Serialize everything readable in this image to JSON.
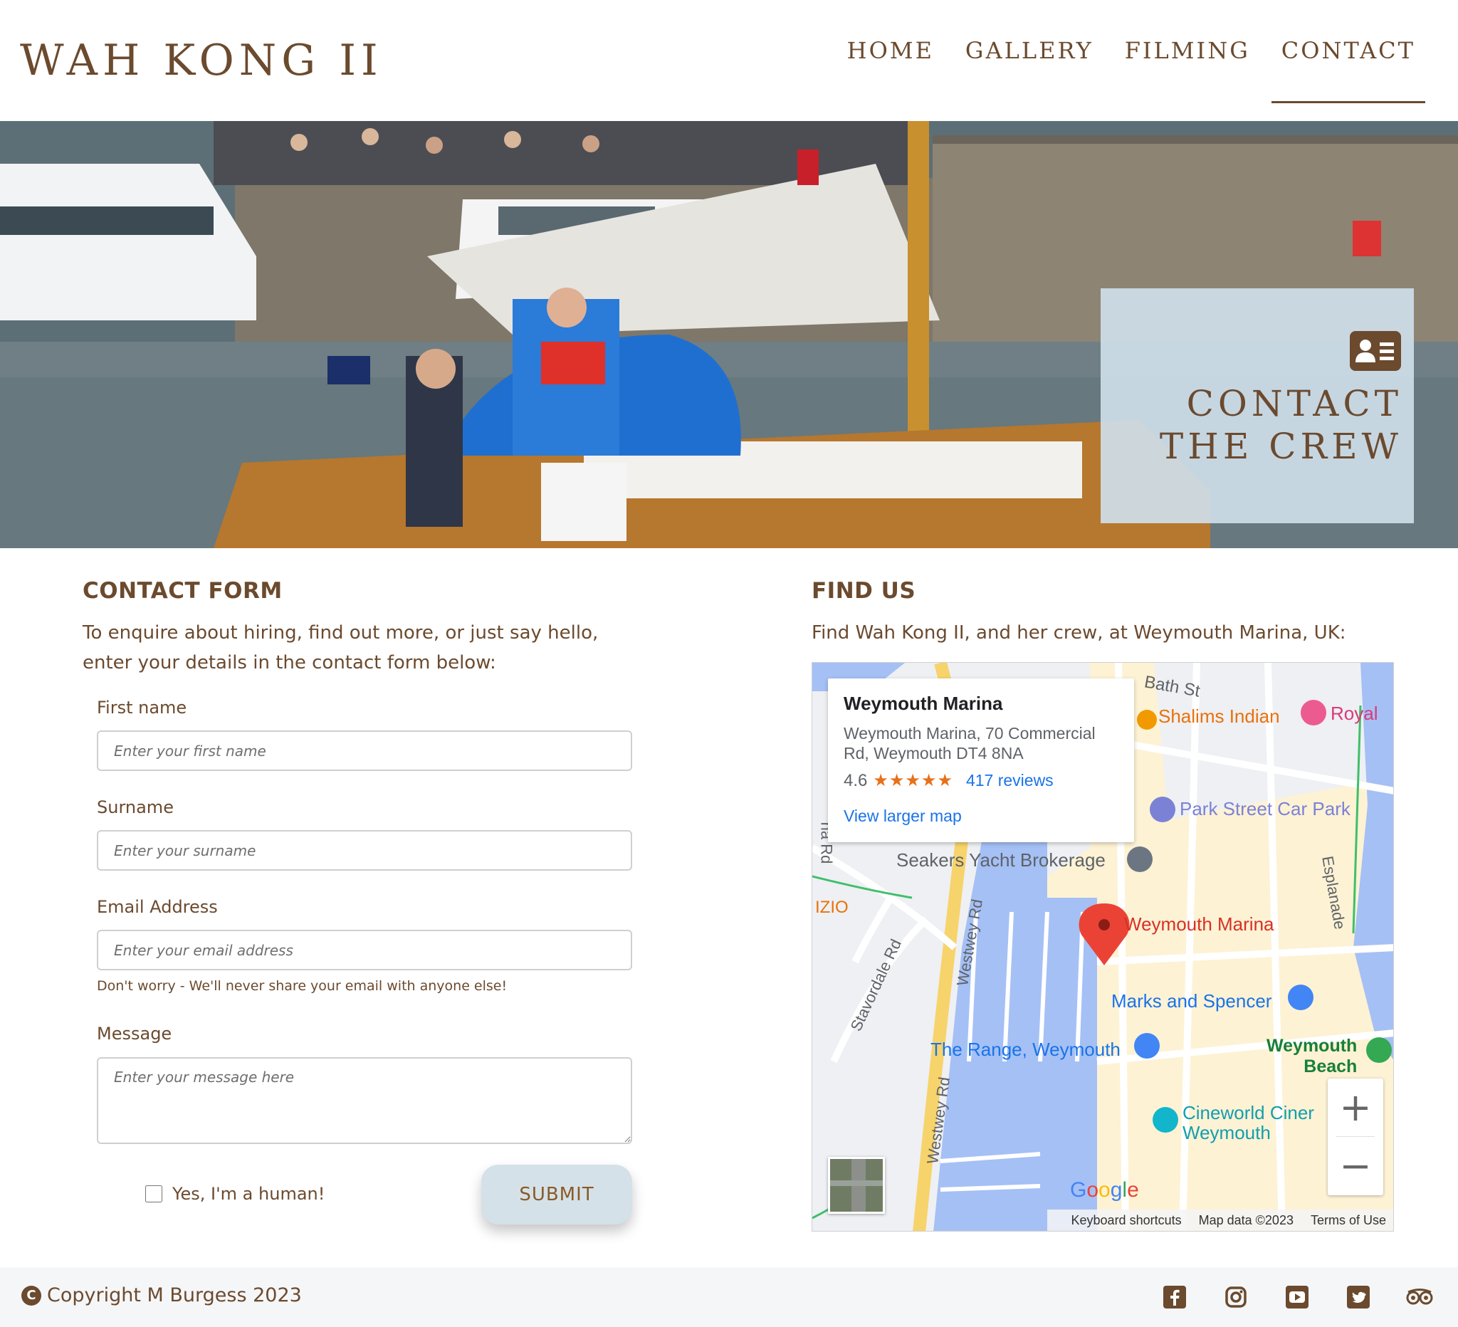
{
  "brand": {
    "title": "WAH KONG II"
  },
  "nav": {
    "items": [
      {
        "label": "HOME",
        "active": false
      },
      {
        "label": "GALLERY",
        "active": false
      },
      {
        "label": "FILMING",
        "active": false
      },
      {
        "label": "CONTACT",
        "active": true
      }
    ]
  },
  "hero": {
    "title_line1": "CONTACT",
    "title_line2": "THE CREW",
    "icon": "address-card-icon"
  },
  "contact_form": {
    "heading": "CONTACT FORM",
    "intro_line1": "To enquire about hiring, find out more, or just say hello,",
    "intro_line2": "enter your details in the contact form below:",
    "first_name": {
      "label": "First name",
      "placeholder": "Enter your first name",
      "value": ""
    },
    "surname": {
      "label": "Surname",
      "placeholder": "Enter your surname",
      "value": ""
    },
    "email": {
      "label": "Email Address",
      "placeholder": "Enter your email address",
      "value": "",
      "hint": "Don't worry - We'll never share your email with anyone else!"
    },
    "message": {
      "label": "Message",
      "placeholder": "Enter your message here",
      "value": ""
    },
    "human_check": {
      "label": "Yes, I'm a human!",
      "checked": false
    },
    "submit_label": "SUBMIT"
  },
  "find_us": {
    "heading": "FIND US",
    "intro": "Find Wah Kong II, and her crew, at Weymouth Marina, UK:"
  },
  "map": {
    "place_name": "Weymouth Marina",
    "address": "Weymouth Marina, 70 Commercial Rd, Weymouth DT4 8NA",
    "rating": "4.6",
    "stars": "★★★★★",
    "reviews": "417 reviews",
    "larger_map": "View larger map",
    "labels": {
      "bath_st": "Bath St",
      "shalims": "Shalims Indian",
      "royal": "Royal",
      "park_street": "Park Street Car Park",
      "seakers": "Seakers Yacht Brokerage",
      "marina_pin": "Weymouth Marina",
      "izio": "IZIO",
      "na_rd": "na Rd",
      "stavordale": "Stavordale Rd",
      "westwey1": "Westwey Rd",
      "westwey2": "Westwey Rd",
      "esplanade": "Esplanade",
      "marks": "Marks and Spencer",
      "range": "The Range, Weymouth",
      "beach1": "Weymouth",
      "beach2": "Beach",
      "cine1": "Cineworld Ciner",
      "cine2": "Weymouth"
    },
    "zoom_in": "+",
    "zoom_out": "−",
    "google": "Google",
    "footer": {
      "shortcuts": "Keyboard shortcuts",
      "data": "Map data ©2023",
      "terms": "Terms of Use"
    },
    "colors": {
      "water": "#a5c0f5",
      "land": "#fdf2d4",
      "road_yellow": "#f7d36b",
      "pin": "#ea4335",
      "link": "#1a73e8"
    }
  },
  "footer": {
    "copyright": "Copyright M Burgess 2023",
    "copyright_icon": "C",
    "social": [
      "facebook-icon",
      "instagram-icon",
      "youtube-icon",
      "twitter-icon",
      "tripadvisor-icon"
    ]
  },
  "colors": {
    "brand_brown": "#6b4a2e",
    "panel_blue": "#cddee8",
    "submit_bg": "#d5e1e8",
    "footer_bg": "#f5f6f8"
  }
}
